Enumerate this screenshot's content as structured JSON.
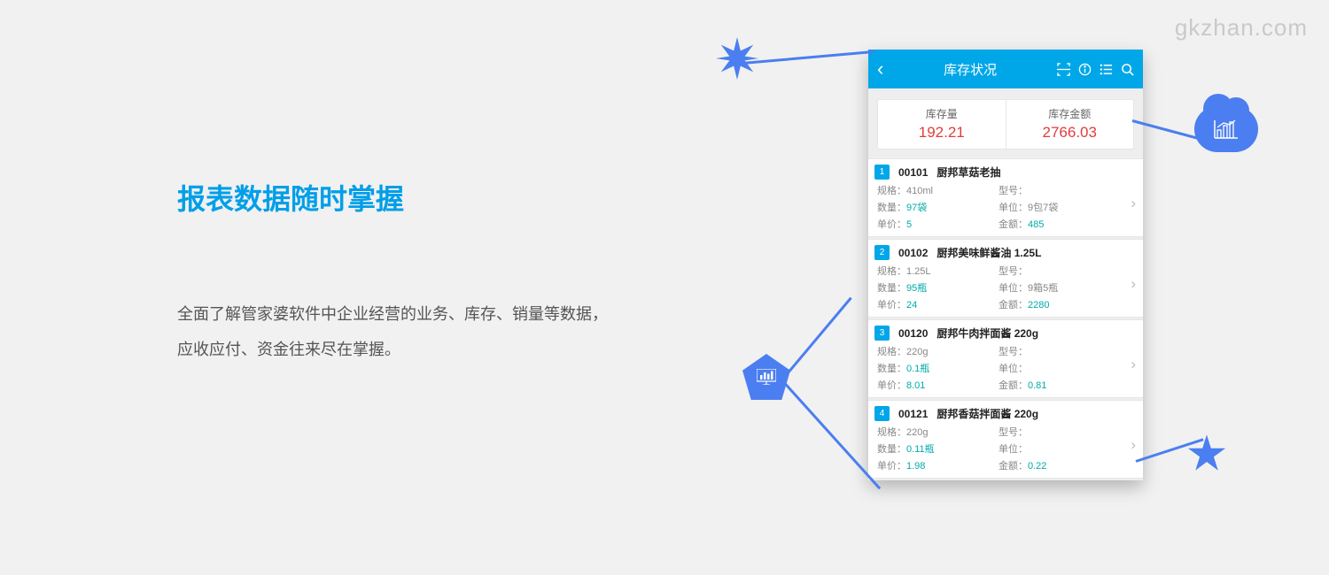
{
  "watermark": "gkzhan.com",
  "left": {
    "heading": "报表数据随时掌握",
    "desc": "全面了解管家婆软件中企业经营的业务、库存、销量等数据，应收应付、资金往来尽在掌握。"
  },
  "app": {
    "title": "库存状况",
    "summary": {
      "qty_label": "库存量",
      "qty_value": "192.21",
      "amount_label": "库存金额",
      "amount_value": "2766.03"
    },
    "labels": {
      "spec": "规格：",
      "model": "型号：",
      "qty": "数量：",
      "unit": "单位：",
      "price": "单价：",
      "amount": "金额："
    },
    "items": [
      {
        "num": "1",
        "code": "00101",
        "name": "厨邦草菇老抽",
        "spec": "410ml",
        "model": "",
        "qty": "97袋",
        "unit": "9包7袋",
        "price": "5",
        "amount": "485"
      },
      {
        "num": "2",
        "code": "00102",
        "name": "厨邦美味鲜酱油 1.25L",
        "spec": "1.25L",
        "model": "",
        "qty": "95瓶",
        "unit": "9箱5瓶",
        "price": "24",
        "amount": "2280"
      },
      {
        "num": "3",
        "code": "00120",
        "name": "厨邦牛肉拌面酱 220g",
        "spec": "220g",
        "model": "",
        "qty": "0.1瓶",
        "unit": "",
        "price": "8.01",
        "amount": "0.81"
      },
      {
        "num": "4",
        "code": "00121",
        "name": "厨邦香菇拌面酱 220g",
        "spec": "220g",
        "model": "",
        "qty": "0.11瓶",
        "unit": "",
        "price": "1.98",
        "amount": "0.22"
      }
    ]
  }
}
